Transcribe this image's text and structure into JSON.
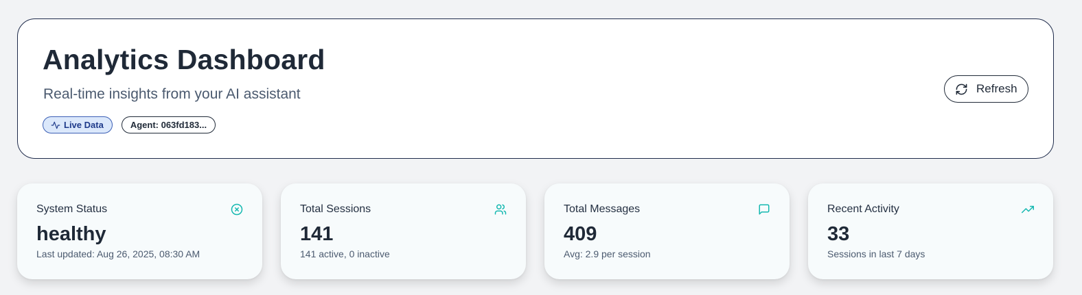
{
  "header": {
    "title": "Analytics Dashboard",
    "subtitle": "Real-time insights from your AI assistant",
    "badges": {
      "live": {
        "label": "Live Data",
        "icon": "activity-icon"
      },
      "agent": {
        "label": "Agent: 063fd183..."
      }
    },
    "refresh_label": "Refresh",
    "refresh_icon": "refresh-icon"
  },
  "stats": [
    {
      "label": "System Status",
      "value": "healthy",
      "detail": "Last updated: Aug 26, 2025, 08:30 AM",
      "icon": "circle-x-icon"
    },
    {
      "label": "Total Sessions",
      "value": "141",
      "detail": "141 active, 0 inactive",
      "icon": "users-icon"
    },
    {
      "label": "Total Messages",
      "value": "409",
      "detail": "Avg: 2.9 per session",
      "icon": "message-icon"
    },
    {
      "label": "Recent Activity",
      "value": "33",
      "detail": "Sessions in last 7 days",
      "icon": "trending-up-icon"
    }
  ],
  "colors": {
    "accent_teal": "#14b8b0",
    "live_badge_bg": "#dbe8fb",
    "live_badge_text": "#1e3a8a",
    "header_border": "#1e2a4a"
  }
}
